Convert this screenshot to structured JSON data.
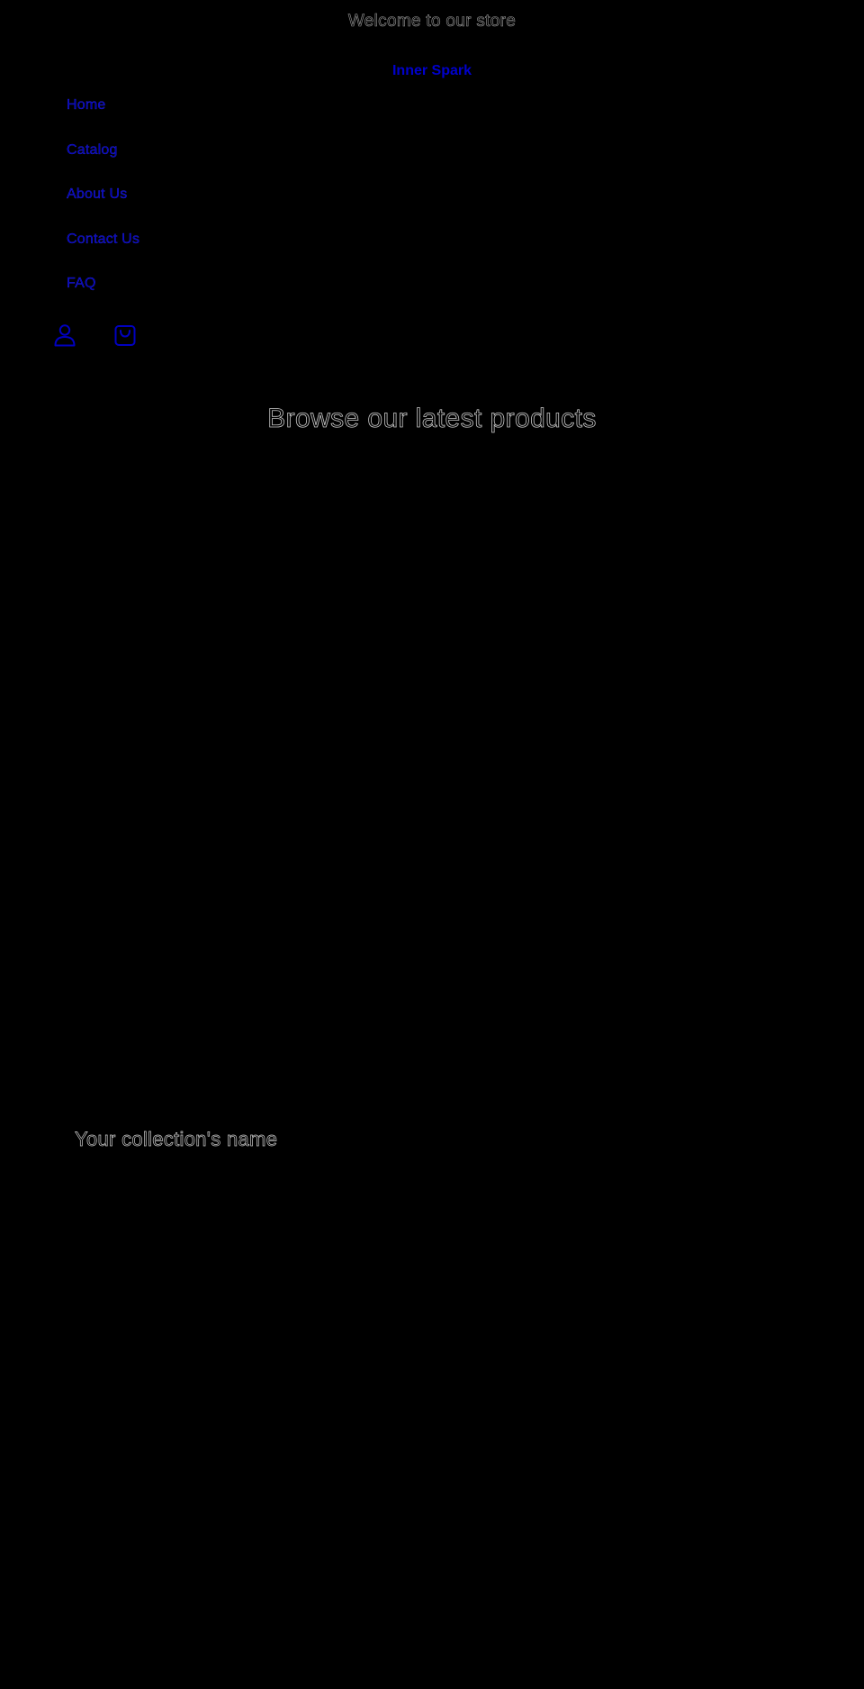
{
  "announcement": {
    "text": "Welcome to our store"
  },
  "header": {
    "store_name": "Inner Spark",
    "nav_items": [
      {
        "label": "Home"
      },
      {
        "label": "Catalog"
      },
      {
        "label": "About Us"
      },
      {
        "label": "Contact Us"
      },
      {
        "label": "FAQ"
      }
    ],
    "icons": {
      "account": "account-icon",
      "cart": "cart-icon"
    }
  },
  "main": {
    "hero_heading": "Browse our latest products",
    "collection_title": "Your collection's name"
  },
  "colors": {
    "background": "#000000",
    "link": "#0000cc",
    "text_outline": "#c8c8c8"
  }
}
